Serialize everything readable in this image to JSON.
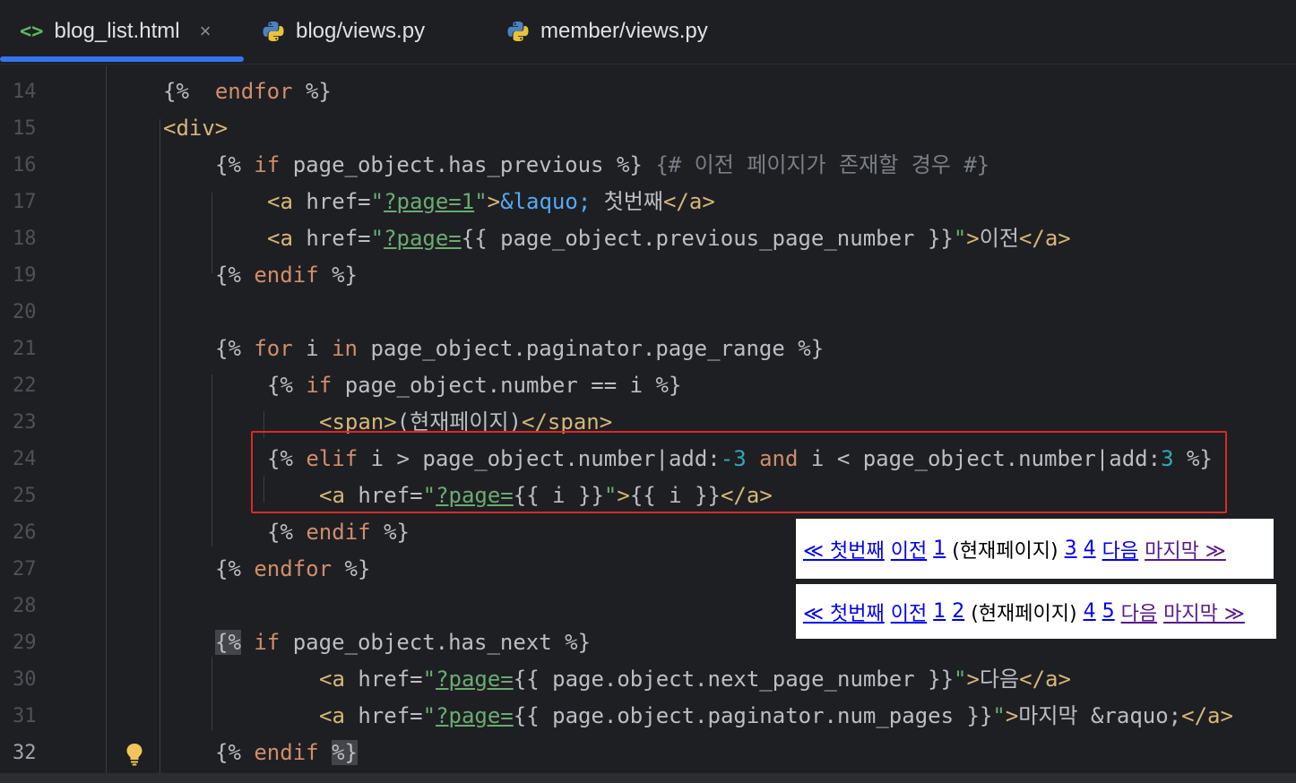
{
  "tabs": [
    {
      "label": "blog_list.html",
      "icon": "html-icon",
      "active": true,
      "close": "×"
    },
    {
      "label": "blog/views.py",
      "icon": "python-icon",
      "active": false
    },
    {
      "label": "member/views.py",
      "icon": "python-icon",
      "active": false
    }
  ],
  "colors": {
    "accent": "#3574f0",
    "highlight_box": "#d62b2b",
    "background": "#1e1f22"
  },
  "line_numbers": [
    "14",
    "15",
    "16",
    "17",
    "18",
    "19",
    "20",
    "21",
    "22",
    "23",
    "24",
    "25",
    "26",
    "27",
    "28",
    "29",
    "30",
    "31",
    "32"
  ],
  "current_line": "32",
  "code": {
    "l14": {
      "a": "{%",
      "b": "endfor",
      "c": "%}"
    },
    "l15": {
      "a": "<div>"
    },
    "l16": {
      "a": "{%",
      "b": "if",
      "c": "page_object.has_previous %}",
      "d": "{# 이전 페이지가 존재할 경우 #}"
    },
    "l17": {
      "a": "<a",
      "b": "href=",
      "q1": "\"",
      "c": "?page=1",
      "q2": "\"",
      "d": ">",
      "e": "&laquo;",
      "f": " 첫번째",
      "g": "</a>"
    },
    "l18": {
      "a": "<a",
      "b": "href=",
      "q1": "\"",
      "c": "?page=",
      "d": "{{ page_object.previous_page_number }}",
      "q2": "\"",
      "e": ">",
      "f": "이전",
      "g": "</a>"
    },
    "l19": {
      "a": "{%",
      "b": "endif",
      "c": "%}"
    },
    "l21": {
      "a": "{%",
      "b": "for",
      "c": "i",
      "d": "in",
      "e": "page_object.paginator.page_range %}"
    },
    "l22": {
      "a": "{%",
      "b": "if",
      "c": "page_object.number == i %}"
    },
    "l23": {
      "a": "<span>",
      "b": "(현재페이지)",
      "c": "</span>"
    },
    "l24": {
      "a": "{%",
      "b": "elif",
      "c": "i > page_object.number|add:",
      "d": "-3",
      "e": "and",
      "f": "i < page_object.number|add:",
      "g": "3",
      "h": "%}"
    },
    "l25": {
      "a": "<a",
      "b": "href=",
      "q1": "\"",
      "c": "?page=",
      "d": "{{ i }}",
      "q2": "\"",
      "e": ">",
      "f": "{{ i }}",
      "g": "</a>"
    },
    "l26": {
      "a": "{%",
      "b": "endif",
      "c": "%}"
    },
    "l27": {
      "a": "{%",
      "b": "endfor",
      "c": "%}"
    },
    "l29": {
      "a": "{%",
      "b": "if",
      "c": "page_object.has_next %}"
    },
    "l30": {
      "a": "<a",
      "b": "href=",
      "q1": "\"",
      "c": "?page=",
      "d": "{{ page.object.next_page_number }}",
      "q2": "\"",
      "e": ">",
      "f": "다음",
      "g": "</a>"
    },
    "l31": {
      "a": "<a",
      "b": "href=",
      "q1": "\"",
      "c": "?page=",
      "d": "{{ page.object.paginator.num_pages }}",
      "q2": "\"",
      "e": ">",
      "f": "마지막 &raquo;",
      "g": "</a>"
    },
    "l32": {
      "a": "{%",
      "b": "endif",
      "c": "%}"
    }
  },
  "preview1": {
    "first": "≪ 첫번째",
    "prev": "이전",
    "p1": "1",
    "current": "(현재페이지)",
    "p3": "3",
    "p4": "4",
    "next": "다음",
    "last": "마지막 ≫"
  },
  "preview2": {
    "first": "≪ 첫번째",
    "prev": "이전",
    "p1": "1",
    "p2": "2",
    "current": "(현재페이지)",
    "p4": "4",
    "p5": "5",
    "next": "다음",
    "last": "마지막 ≫"
  }
}
